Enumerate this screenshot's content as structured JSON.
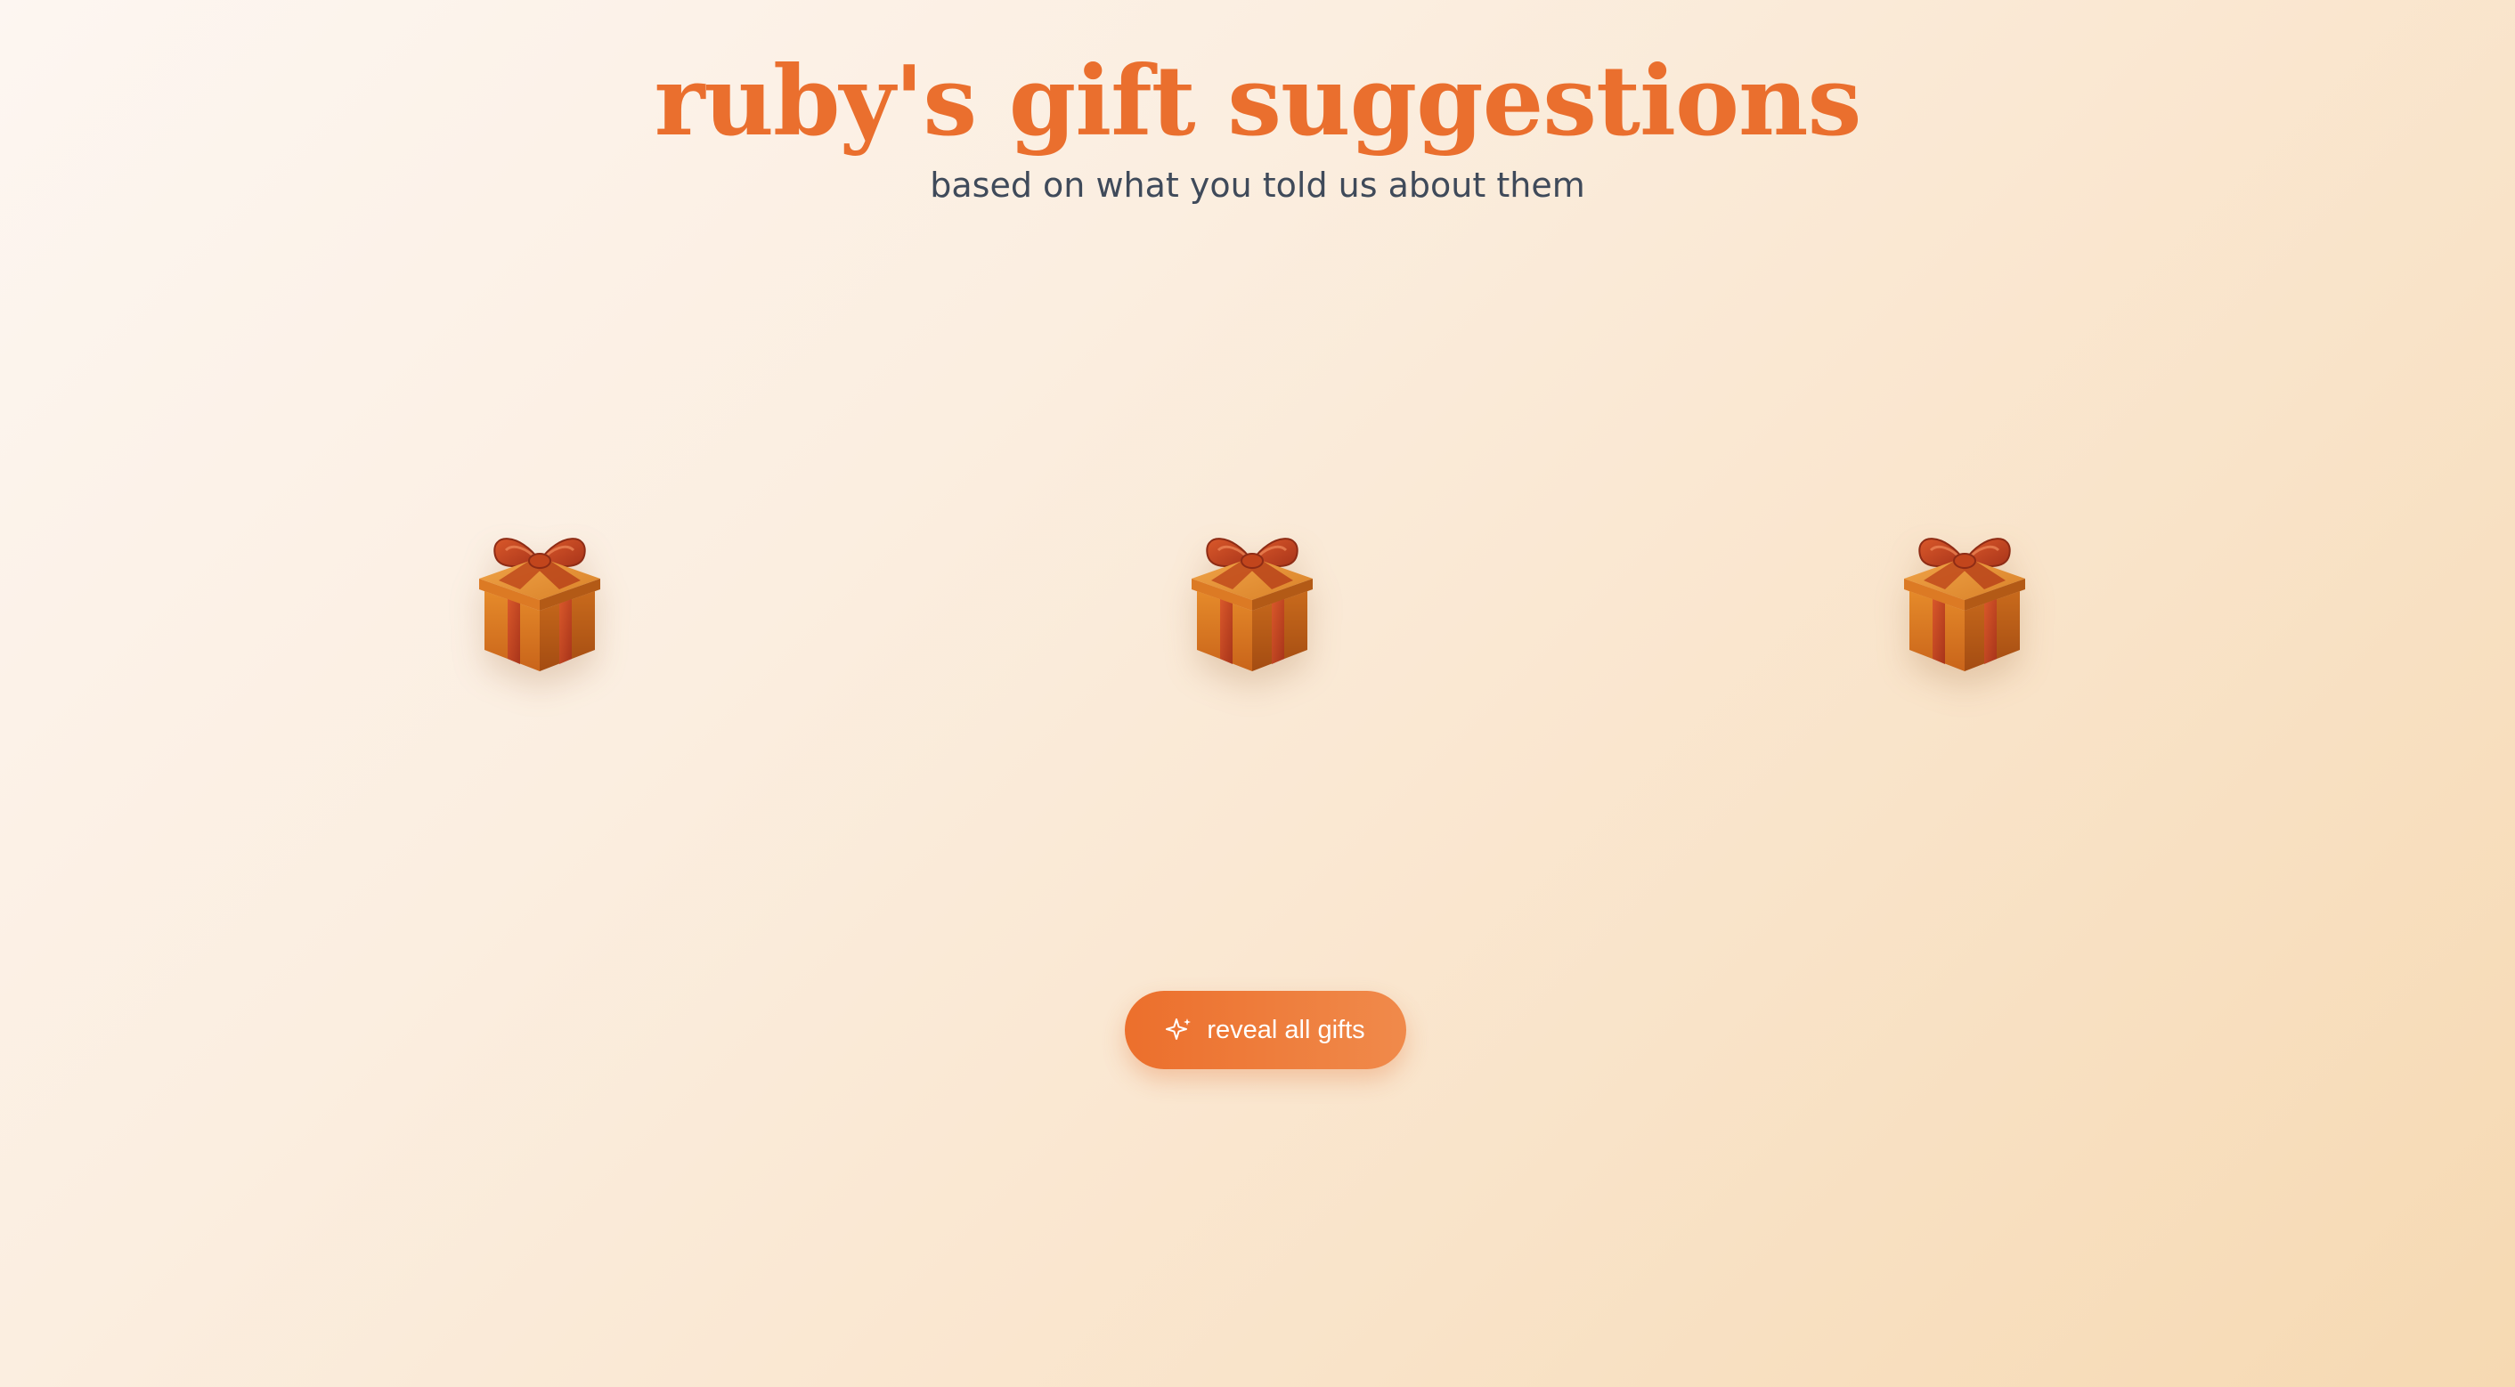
{
  "header": {
    "title": "ruby's gift suggestions",
    "subtitle": "based on what you told us about them"
  },
  "gifts": [
    {
      "icon": "gift-box-icon"
    },
    {
      "icon": "gift-box-icon"
    },
    {
      "icon": "gift-box-icon"
    }
  ],
  "reveal_button": {
    "label": "reveal all gifts",
    "icon": "sparkle-icon"
  },
  "colors": {
    "accent": "#ea6f2e",
    "subtitle": "#3f4a5a",
    "gift_box": "#d9761f",
    "gift_ribbon": "#b8431a"
  }
}
